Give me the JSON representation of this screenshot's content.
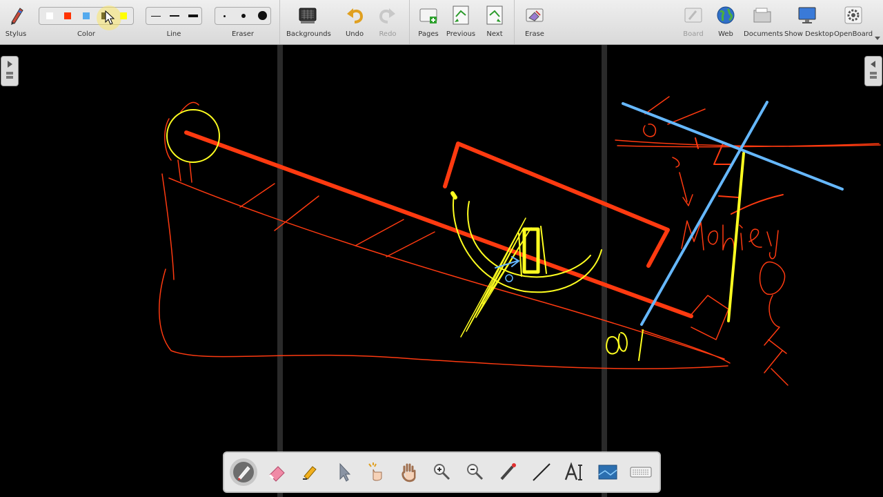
{
  "toolbar": {
    "stylus": "Stylus",
    "color": "Color",
    "line": "Line",
    "eraser": "Eraser",
    "backgrounds": "Backgrounds",
    "undo": "Undo",
    "redo": "Redo",
    "pages": "Pages",
    "previous": "Previous",
    "next": "Next",
    "erase": "Erase",
    "board": "Board",
    "web": "Web",
    "documents": "Documents",
    "show_desktop": "Show Desktop",
    "openboard": "OpenBoard"
  },
  "colors": {
    "swatches": [
      "#ffffff",
      "#ff3300",
      "#55aaee",
      "#0b0b0b",
      "#ffff00"
    ],
    "ink_red": "#ff3a10",
    "ink_yellow": "#ffff20",
    "ink_blue": "#66b8ff",
    "background": "#000000"
  },
  "dock": {
    "tools": [
      "pen-icon",
      "eraser-icon",
      "highlighter-icon",
      "selector-icon",
      "interactive-pointer-icon",
      "hand-icon",
      "zoom-in-icon",
      "zoom-out-icon",
      "laser-pointer-icon",
      "line-icon",
      "text-icon",
      "capture-icon",
      "virtual-keyboard-icon"
    ],
    "selected": "pen-icon"
  }
}
